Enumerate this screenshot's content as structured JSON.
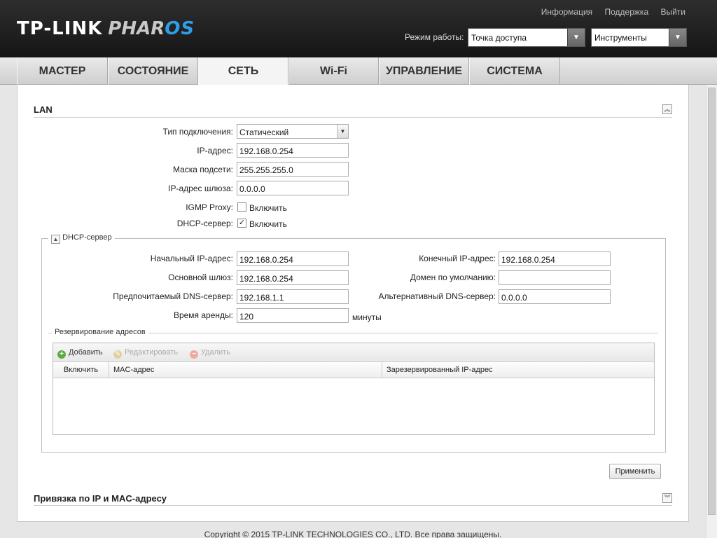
{
  "header": {
    "logo_brand": "TP-LINK",
    "logo_product": "PHAR",
    "logo_product_accent": "OS",
    "links": [
      "Информация",
      "Поддержка",
      "Выйти"
    ],
    "mode_label": "Режим работы:",
    "mode_value": "Точка доступа",
    "tools_value": "Инструменты"
  },
  "nav": {
    "tabs": [
      "МАСТЕР",
      "СОСТОЯНИЕ",
      "СЕТЬ",
      "Wi-Fi",
      "УПРАВЛЕНИЕ",
      "СИСТЕМА"
    ],
    "active": "СЕТЬ"
  },
  "lan": {
    "title": "LAN",
    "conn_type_label": "Тип подключения:",
    "conn_type_value": "Статический",
    "ip_label": "IP-адрес:",
    "ip_value": "192.168.0.254",
    "mask_label": "Маска подсети:",
    "mask_value": "255.255.255.0",
    "gw_label": "IP-адрес шлюза:",
    "gw_value": "0.0.0.0",
    "igmp_label": "IGMP Proxy:",
    "igmp_checked": false,
    "igmp_text": "Включить",
    "dhcp_label": "DHCP-сервер:",
    "dhcp_checked": true,
    "dhcp_text": "Включить"
  },
  "dhcp": {
    "legend": "DHCP-сервер",
    "start_label": "Начальный IP-адрес:",
    "start_value": "192.168.0.254",
    "end_label": "Конечный IP-адрес:",
    "end_value": "192.168.0.254",
    "gw_label": "Основной шлюз:",
    "gw_value": "192.168.0.254",
    "domain_label": "Домен по умолчанию:",
    "domain_value": "",
    "dns1_label": "Предпочитаемый DNS-сервер:",
    "dns1_value": "192.168.1.1",
    "dns2_label": "Альтернативный DNS-сервер:",
    "dns2_value": "0.0.0.0",
    "lease_label": "Время аренды:",
    "lease_value": "120",
    "lease_unit": "минуты"
  },
  "reservation": {
    "legend": "Резервирование адресов",
    "add": "Добавить",
    "edit": "Редактировать",
    "delete": "Удалить",
    "columns": [
      "Включить",
      "MAC-адрес",
      "Зарезервированный IP-адрес"
    ]
  },
  "apply_button": "Применить",
  "binding_title": "Привязка по IP и MAC-адресу",
  "footer": "Copyright © 2015 TP-LINK TECHNOLOGIES CO., LTD. Все права защищены.",
  "colors": {
    "accent": "#2e9ee6",
    "header_bg": "#1e1e1e"
  }
}
